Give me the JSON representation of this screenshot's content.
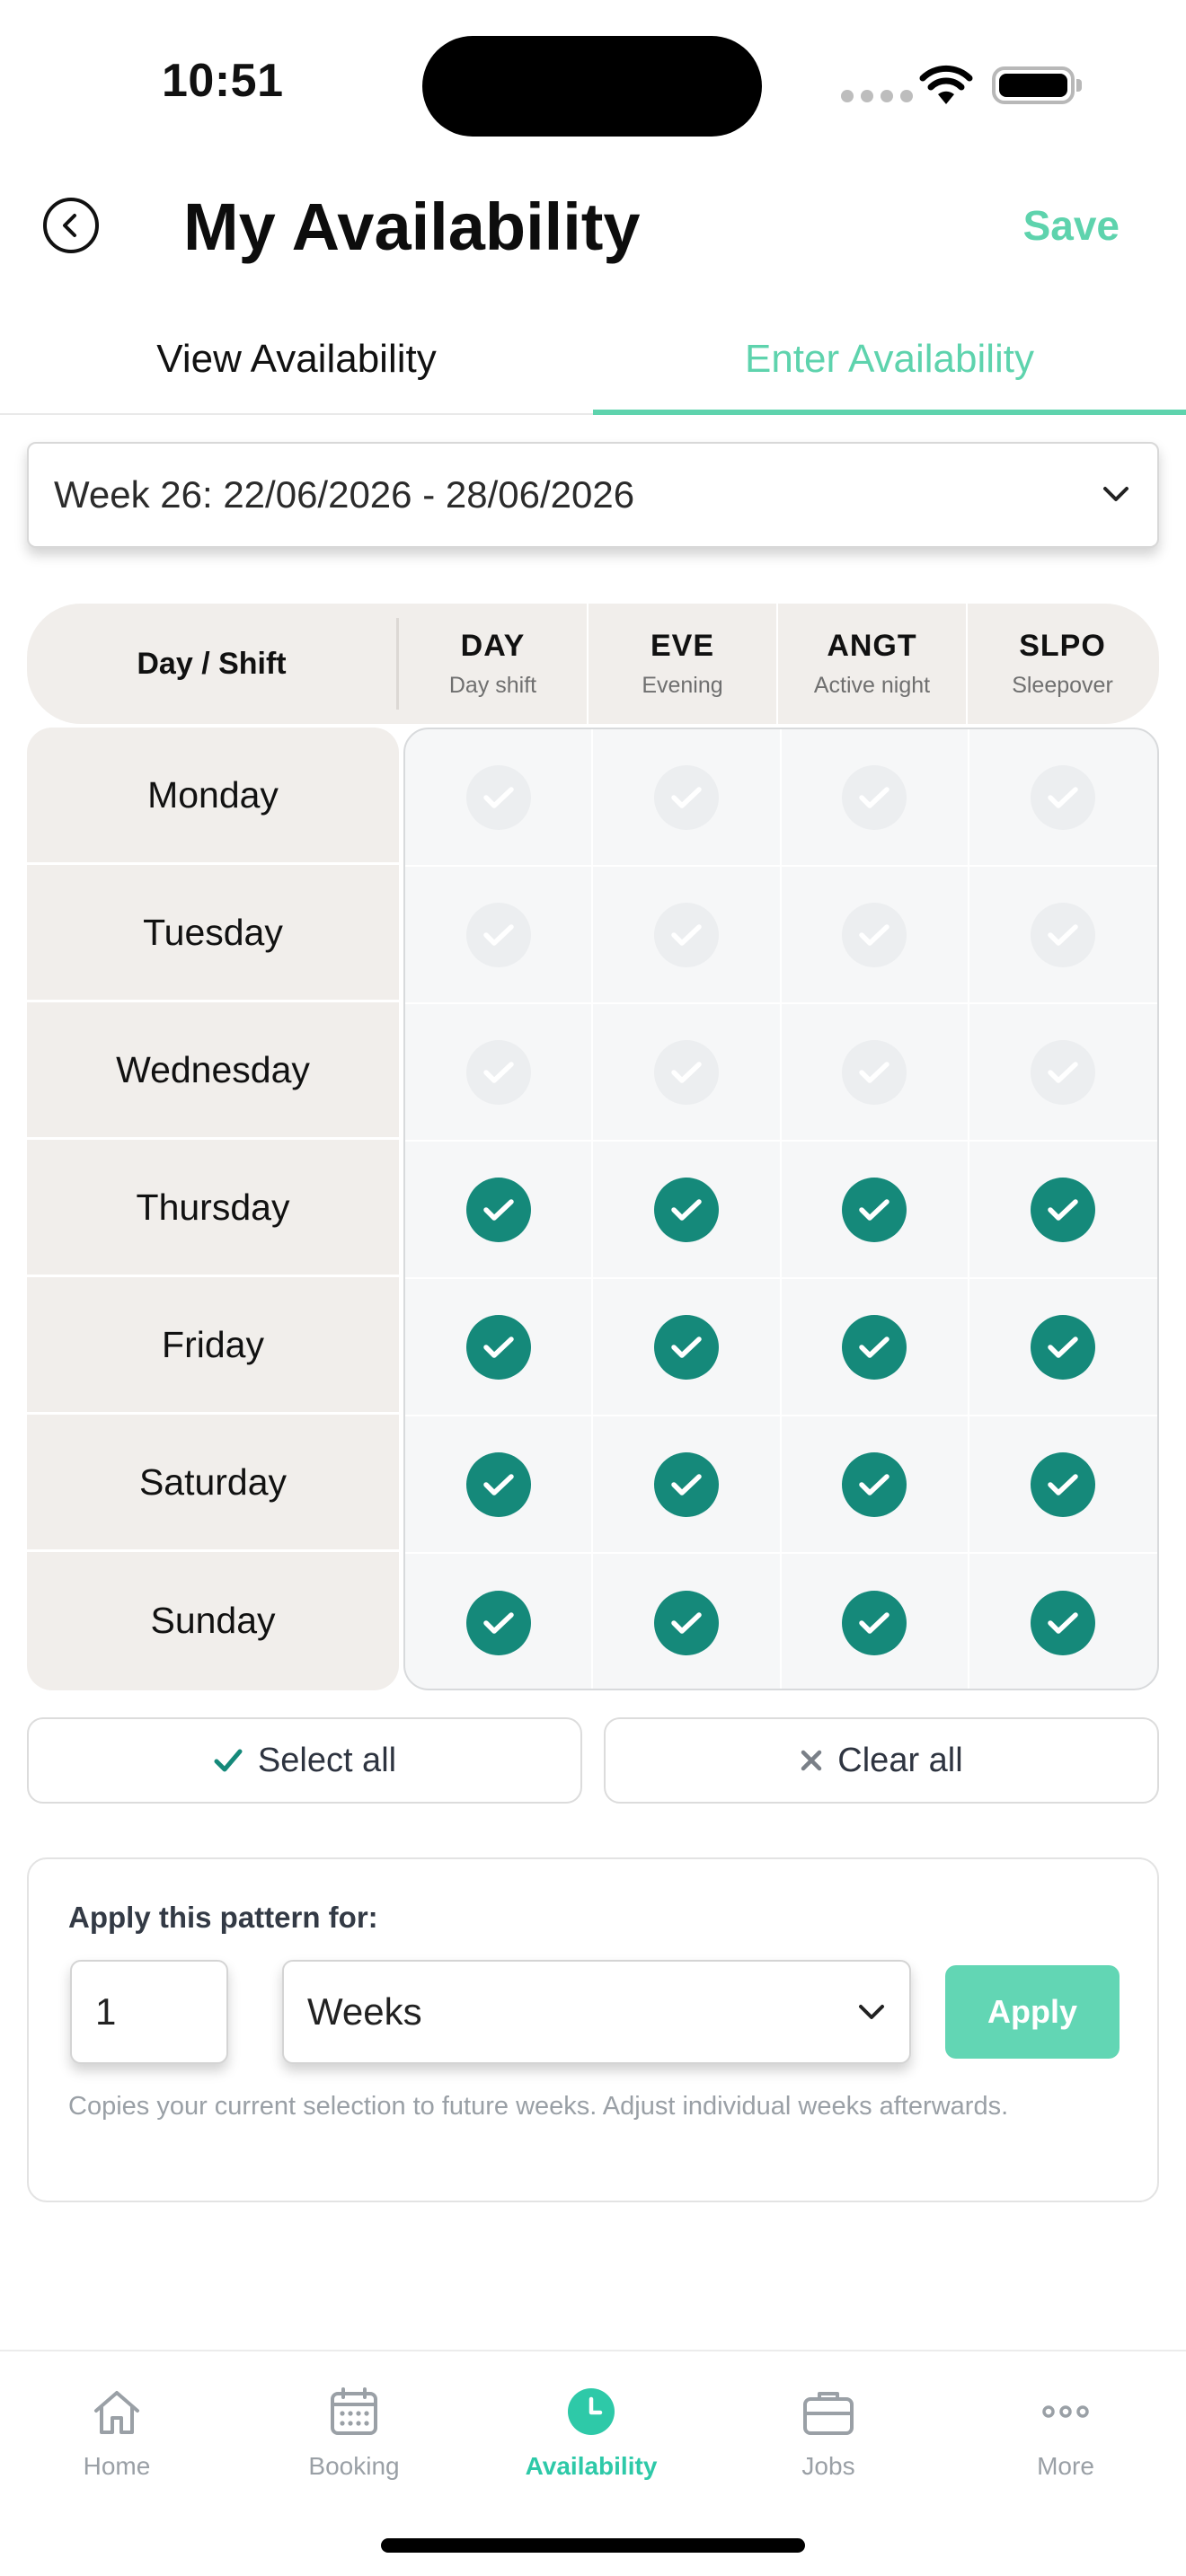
{
  "status_bar": {
    "time": "10:51"
  },
  "header": {
    "title": "My Availability",
    "save_label": "Save"
  },
  "tabs": [
    {
      "label": "View Availability",
      "active": false
    },
    {
      "label": "Enter Availability",
      "active": true
    }
  ],
  "week_selector": {
    "value": "Week 26: 22/06/2026 - 28/06/2026"
  },
  "grid": {
    "corner_label": "Day / Shift",
    "shifts": [
      {
        "code": "DAY",
        "desc": "Day shift"
      },
      {
        "code": "EVE",
        "desc": "Evening"
      },
      {
        "code": "ANGT",
        "desc": "Active night"
      },
      {
        "code": "SLPO",
        "desc": "Sleepover"
      }
    ],
    "days": [
      {
        "name": "Monday",
        "available": [
          false,
          false,
          false,
          false
        ]
      },
      {
        "name": "Tuesday",
        "available": [
          false,
          false,
          false,
          false
        ]
      },
      {
        "name": "Wednesday",
        "available": [
          false,
          false,
          false,
          false
        ]
      },
      {
        "name": "Thursday",
        "available": [
          true,
          true,
          true,
          true
        ]
      },
      {
        "name": "Friday",
        "available": [
          true,
          true,
          true,
          true
        ]
      },
      {
        "name": "Saturday",
        "available": [
          true,
          true,
          true,
          true
        ]
      },
      {
        "name": "Sunday",
        "available": [
          true,
          true,
          true,
          true
        ]
      }
    ]
  },
  "actions": {
    "select_all": "Select all",
    "clear_all": "Clear all"
  },
  "pattern": {
    "label": "Apply this pattern for:",
    "count": "1",
    "unit": "Weeks",
    "apply_label": "Apply",
    "hint": "Copies your current selection to future weeks. Adjust individual weeks afterwards."
  },
  "bottom_nav": [
    {
      "label": "Home",
      "icon": "home-icon",
      "active": false
    },
    {
      "label": "Booking",
      "icon": "calendar-icon",
      "active": false
    },
    {
      "label": "Availability",
      "icon": "clock-icon",
      "active": true
    },
    {
      "label": "Jobs",
      "icon": "briefcase-icon",
      "active": false
    },
    {
      "label": "More",
      "icon": "more-icon",
      "active": false
    }
  ],
  "colors": {
    "accent": "#5ed3ad",
    "check_on": "#15897a",
    "check_off": "#eceef0",
    "day_column_bg": "#f1eeeb"
  }
}
